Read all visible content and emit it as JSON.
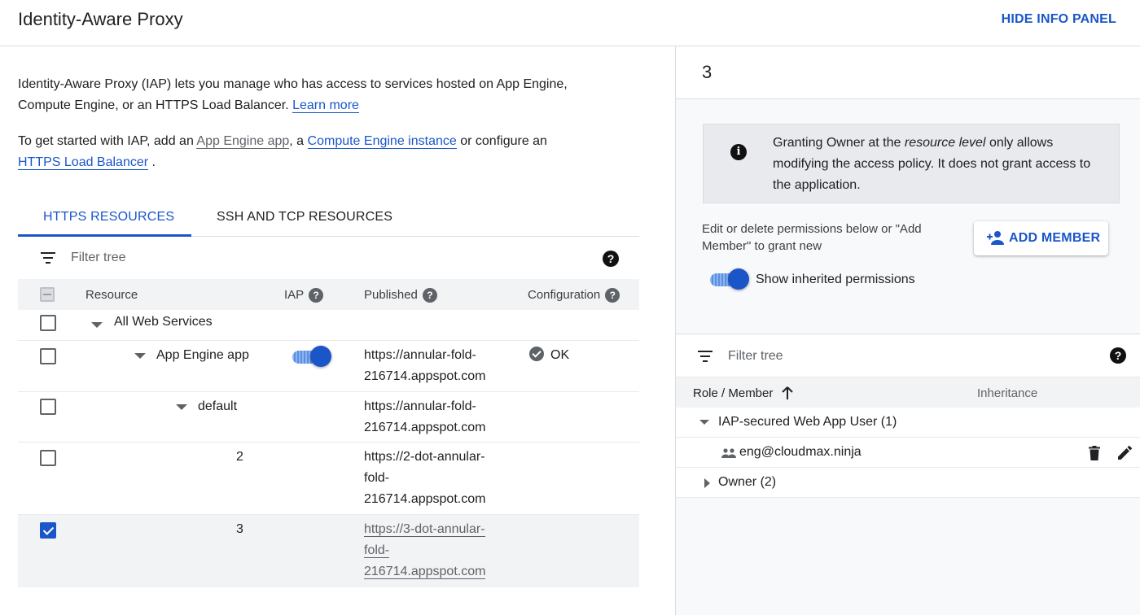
{
  "header": {
    "title": "Identity-Aware Proxy",
    "hide_panel": "HIDE INFO PANEL"
  },
  "intro": {
    "p1_text": "Identity-Aware Proxy (IAP) lets you manage who has access to services hosted on App Engine, Compute Engine, or an HTTPS Load Balancer.",
    "p1_link": "Learn more",
    "p2_a": "To get started with IAP, add an",
    "p2_link1": "App Engine app",
    "p2_b": ", a",
    "p2_link2": "Compute Engine instance",
    "p2_c": "or configure an",
    "p2_link3": "HTTPS Load Balancer",
    "p2_d": "."
  },
  "tabs": [
    "HTTPS RESOURCES",
    "SSH AND TCP RESOURCES"
  ],
  "filter": {
    "placeholder": "Filter tree",
    "help": "?"
  },
  "table": {
    "columns": {
      "resource": "Resource",
      "iap": "IAP",
      "published": "Published",
      "configuration": "Configuration"
    },
    "rows": [
      {
        "name": "All Web Services",
        "checked": false
      },
      {
        "name": "App Engine app",
        "checked": false,
        "iap_on": true,
        "published": "https://annular-fold-216714.appspot.com",
        "configuration": "OK"
      },
      {
        "name": "default",
        "checked": false,
        "published": "https://annular-fold-216714.appspot.com"
      },
      {
        "name": "2",
        "checked": false,
        "published": "https://2-dot-annular-fold-216714.appspot.com"
      },
      {
        "name": "3",
        "checked": true,
        "published": "https://3-dot-annular-fold-216714.appspot.com"
      }
    ]
  },
  "info_panel": {
    "title": "3",
    "notice_pre": "Granting Owner at the",
    "notice_em": "resource level",
    "notice_post": "only allows modifying the access policy. It does not grant access to the application.",
    "edit_text": "Edit or delete permissions below or \"Add Member\" to grant new",
    "add_member": "ADD MEMBER",
    "show_inherited": "Show inherited permissions",
    "show_inherited_on": true,
    "filter_placeholder": "Filter tree",
    "columns": {
      "role_member": "Role / Member",
      "inheritance": "Inheritance"
    },
    "roles": [
      {
        "name": "IAP-secured Web App User (1)",
        "expanded": true,
        "members": [
          "eng@cloudmax.ninja"
        ]
      },
      {
        "name": "Owner (2)",
        "expanded": false
      }
    ]
  },
  "colors": {
    "accent": "#1a56c8",
    "text": "#202124",
    "muted": "#5f6368",
    "panel_bg": "#f8f9fa"
  }
}
